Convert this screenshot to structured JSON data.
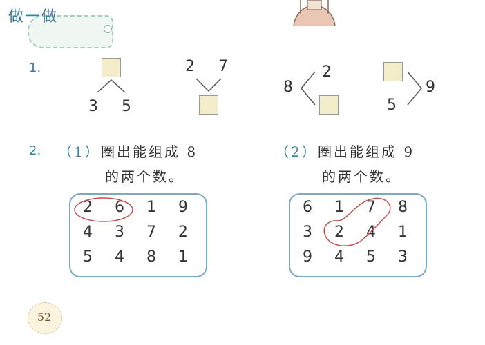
{
  "heading": "做一做",
  "page_number": "52",
  "ex1": {
    "label": "1.",
    "a": {
      "left": "3",
      "right": "5"
    },
    "b": {
      "left": "2",
      "right": "7"
    },
    "c": {
      "left": "8",
      "top": "2"
    },
    "d": {
      "bottom": "5",
      "right": "9"
    }
  },
  "ex2": {
    "label": "2.",
    "part1": {
      "tag": "（1）",
      "line1": "圈出能组成 8",
      "line2": "的两个数。",
      "rows": [
        [
          "2",
          "6",
          "1",
          "9"
        ],
        [
          "4",
          "3",
          "7",
          "2"
        ],
        [
          "5",
          "4",
          "8",
          "1"
        ]
      ]
    },
    "part2": {
      "tag": "（2）",
      "line1": "圈出能组成 9",
      "line2": "的两个数。",
      "rows": [
        [
          "6",
          "1",
          "7",
          "8"
        ],
        [
          "3",
          "2",
          "4",
          "1"
        ],
        [
          "9",
          "4",
          "5",
          "3"
        ]
      ]
    }
  },
  "colors": {
    "accent": "#3c7f9c",
    "box_fill": "#f3edc9",
    "circle": "#c0504d",
    "frame": "#7aa9c6"
  }
}
